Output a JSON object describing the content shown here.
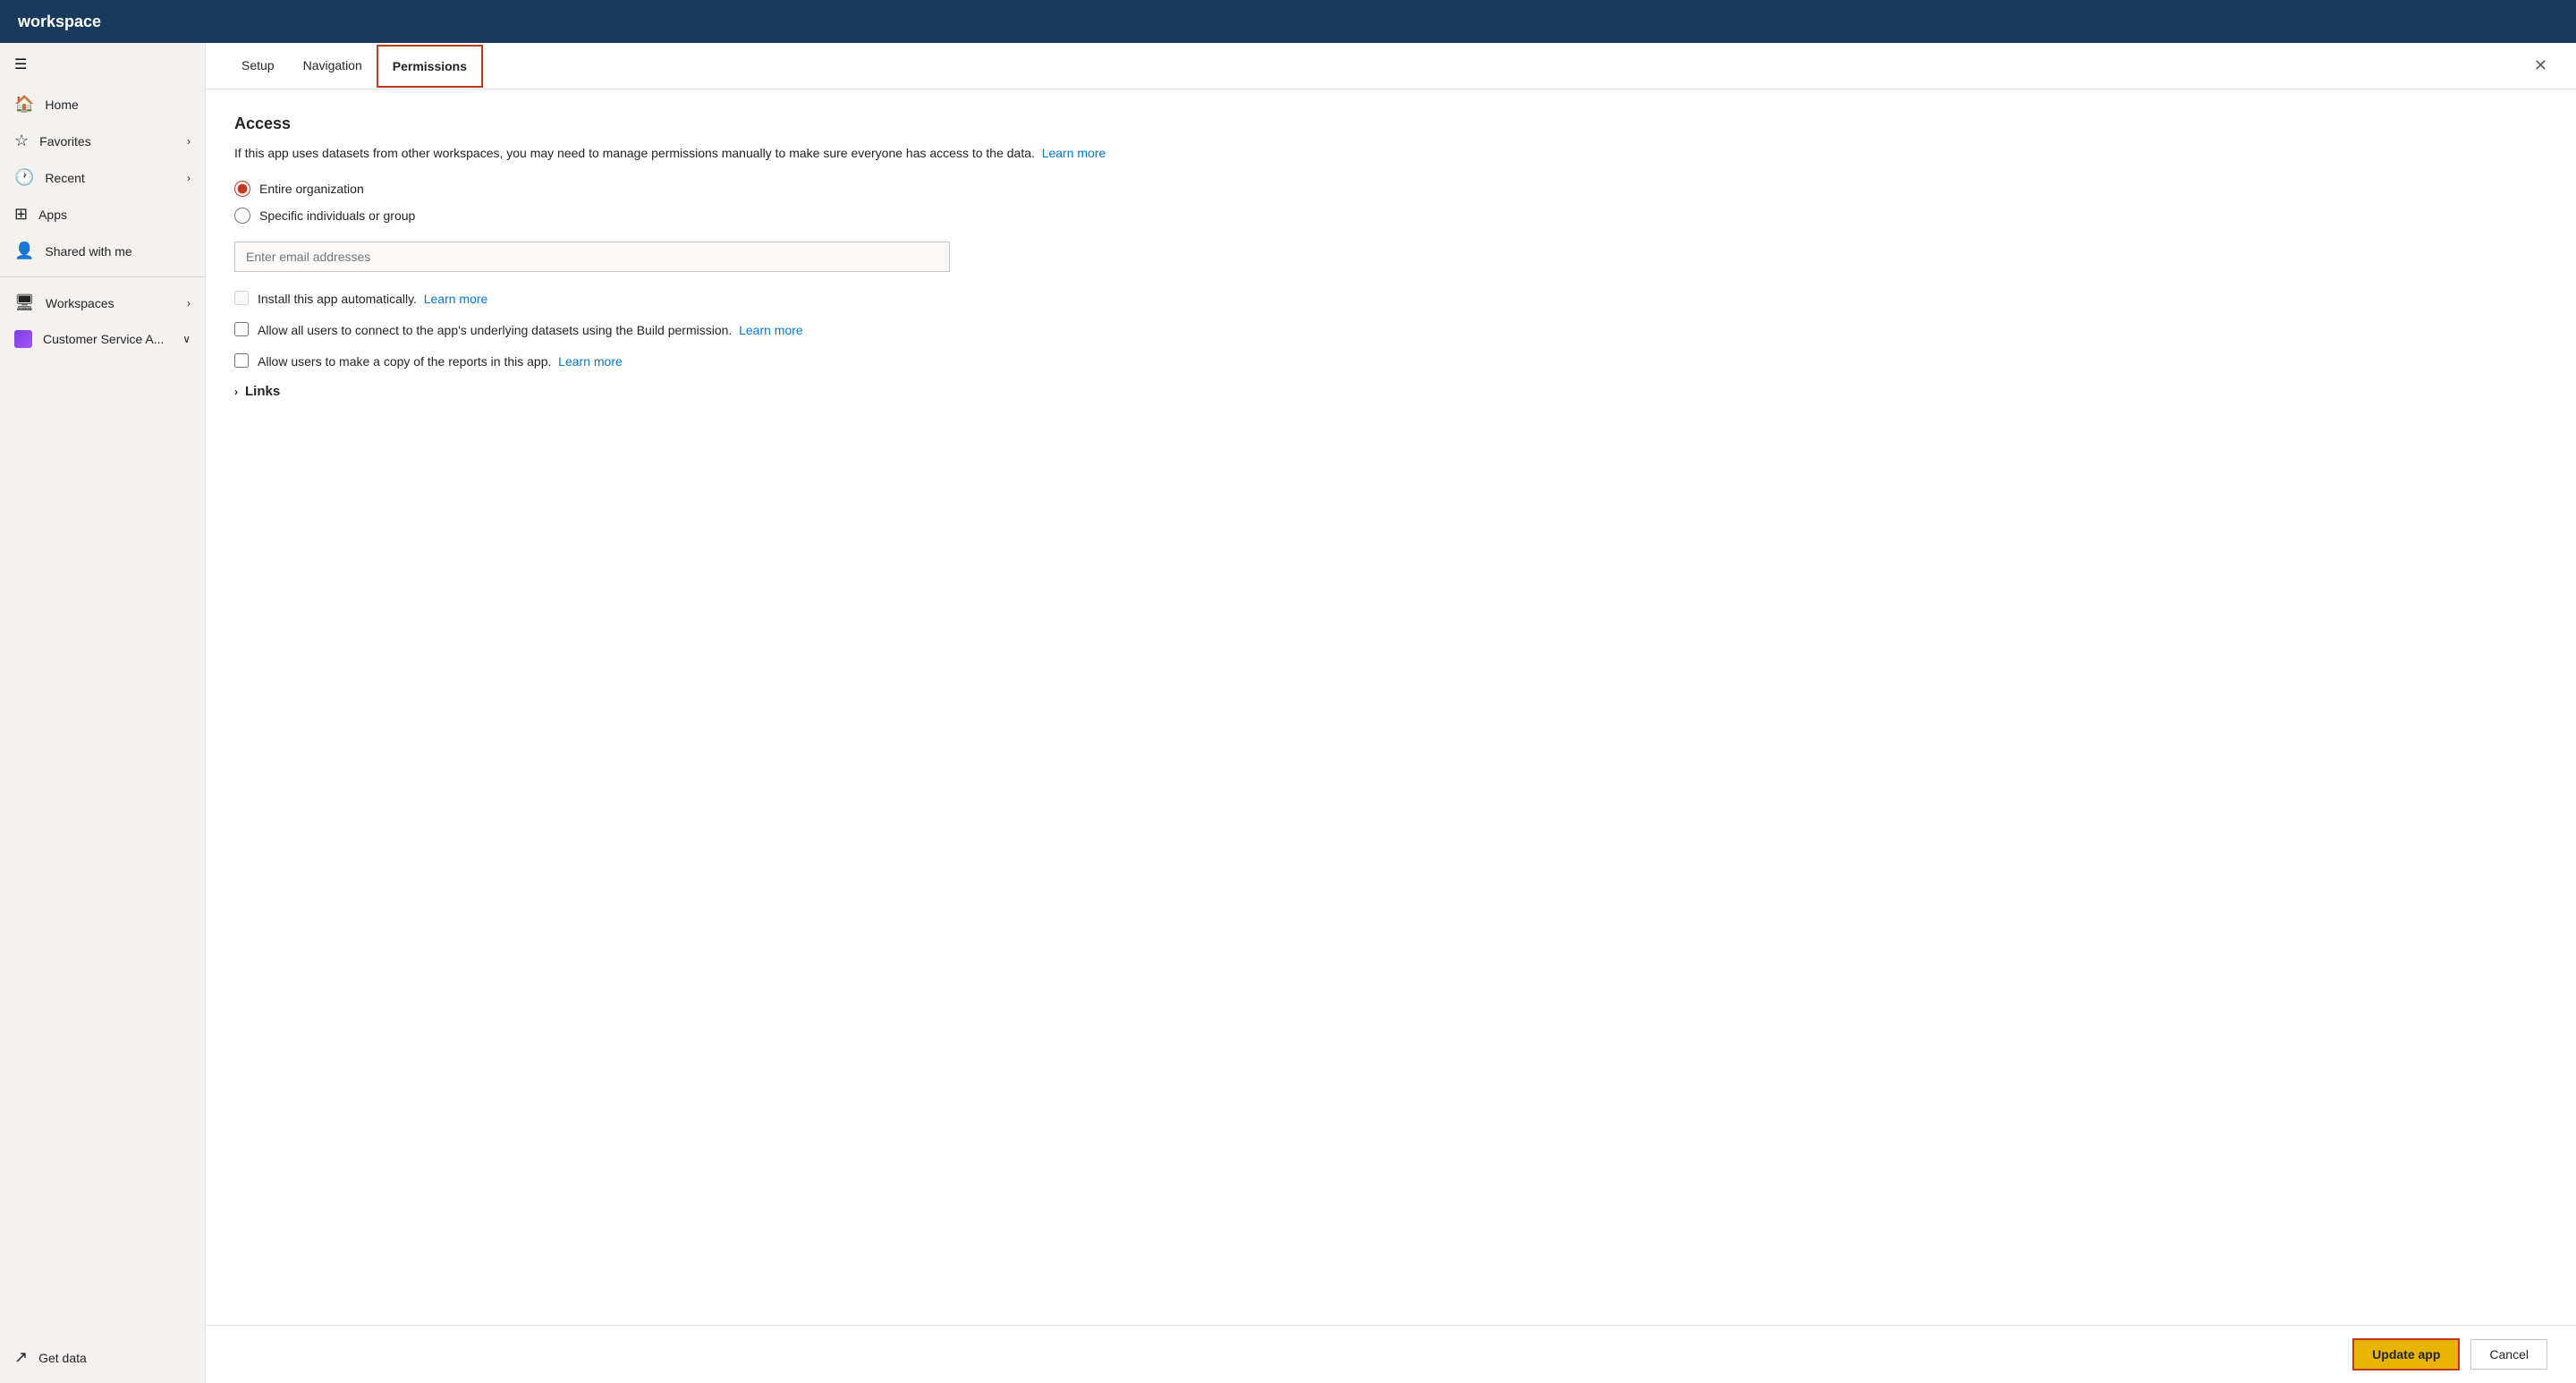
{
  "topbar": {
    "title": "workspace"
  },
  "sidebar": {
    "hamburger_icon": "☰",
    "items": [
      {
        "id": "home",
        "label": "Home",
        "icon": "🏠",
        "has_chevron": false
      },
      {
        "id": "favorites",
        "label": "Favorites",
        "icon": "☆",
        "has_chevron": true
      },
      {
        "id": "recent",
        "label": "Recent",
        "icon": "🕐",
        "has_chevron": true
      },
      {
        "id": "apps",
        "label": "Apps",
        "icon": "⊞",
        "has_chevron": false
      },
      {
        "id": "shared",
        "label": "Shared with me",
        "icon": "👤",
        "has_chevron": false
      },
      {
        "id": "workspaces",
        "label": "Workspaces",
        "icon": "🖥",
        "has_chevron": true
      },
      {
        "id": "customer",
        "label": "Customer Service A...",
        "icon": "purple",
        "has_chevron": true
      }
    ],
    "bottom_items": [
      {
        "id": "get-data",
        "label": "Get data",
        "icon": "↗"
      }
    ]
  },
  "tabs": {
    "items": [
      {
        "id": "setup",
        "label": "Setup",
        "active": false
      },
      {
        "id": "navigation",
        "label": "Navigation",
        "active": false
      },
      {
        "id": "permissions",
        "label": "Permissions",
        "active": true
      }
    ],
    "close_icon": "✕"
  },
  "permissions": {
    "access_title": "Access",
    "access_description": "If this app uses datasets from other workspaces, you may need to manage permissions manually to make sure everyone has access to the data.",
    "access_learn_more": "Learn more",
    "radio_options": [
      {
        "id": "entire-org",
        "label": "Entire organization",
        "checked": true
      },
      {
        "id": "specific",
        "label": "Specific individuals or group",
        "checked": false
      }
    ],
    "email_placeholder": "Enter email addresses",
    "checkboxes": [
      {
        "id": "auto-install",
        "label": "Install this app automatically.",
        "learn_more": "Learn more",
        "checked": false,
        "disabled": true
      },
      {
        "id": "build-permission",
        "label": "Allow all users to connect to the app's underlying datasets using the Build permission.",
        "learn_more": "Learn more",
        "checked": false,
        "disabled": false
      },
      {
        "id": "copy-reports",
        "label": "Allow users to make a copy of the reports in this app.",
        "learn_more": "Learn more",
        "checked": false,
        "disabled": false
      }
    ],
    "links_label": "Links"
  },
  "footer": {
    "update_label": "Update app",
    "cancel_label": "Cancel"
  }
}
